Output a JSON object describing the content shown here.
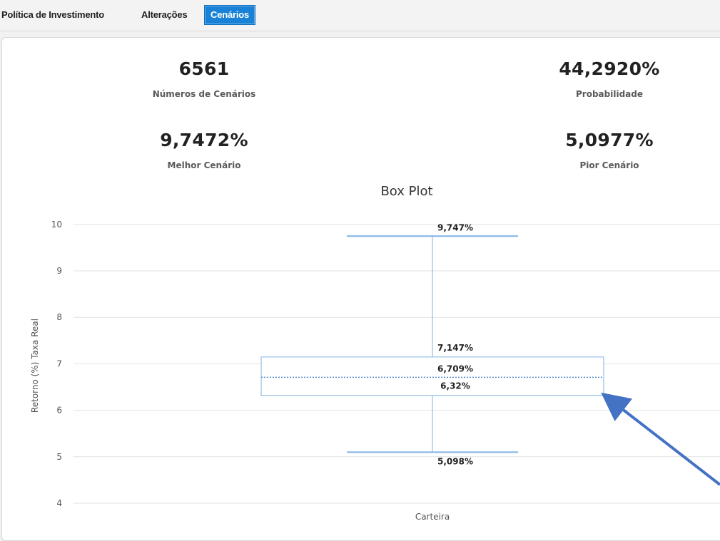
{
  "tabs": [
    {
      "label": "Política de Investimento",
      "active": false
    },
    {
      "label": "Alterações",
      "active": false
    },
    {
      "label": "Cenários",
      "active": true
    }
  ],
  "stats": {
    "scenarios": {
      "value": "6561",
      "label": "Números de Cenários"
    },
    "probability": {
      "value": "44,2920%",
      "label": "Probabilidade"
    },
    "best": {
      "value": "9,7472%",
      "label": "Melhor Cenário"
    },
    "worst": {
      "value": "5,0977%",
      "label": "Pior Cenário"
    }
  },
  "chart_data": {
    "type": "boxplot",
    "title": "Box Plot",
    "ylabel": "Retorno (%) Taxa Real",
    "xlabel": "",
    "categories": [
      "Carteira"
    ],
    "ylim": [
      4,
      10
    ],
    "yticks": [
      4,
      5,
      6,
      7,
      8,
      9,
      10
    ],
    "grid": true,
    "box": {
      "min": 5.098,
      "q1": 6.32,
      "median": 6.709,
      "q3": 7.147,
      "max": 9.747
    },
    "labels": {
      "max": "9,747%",
      "q3": "7,147%",
      "median": "6,709%",
      "q1": "6,32%",
      "min": "5,098%"
    }
  },
  "colors": {
    "accent": "#1a82d6",
    "box": "#7fb1e5",
    "annotation_arrow": "#4472c4"
  }
}
